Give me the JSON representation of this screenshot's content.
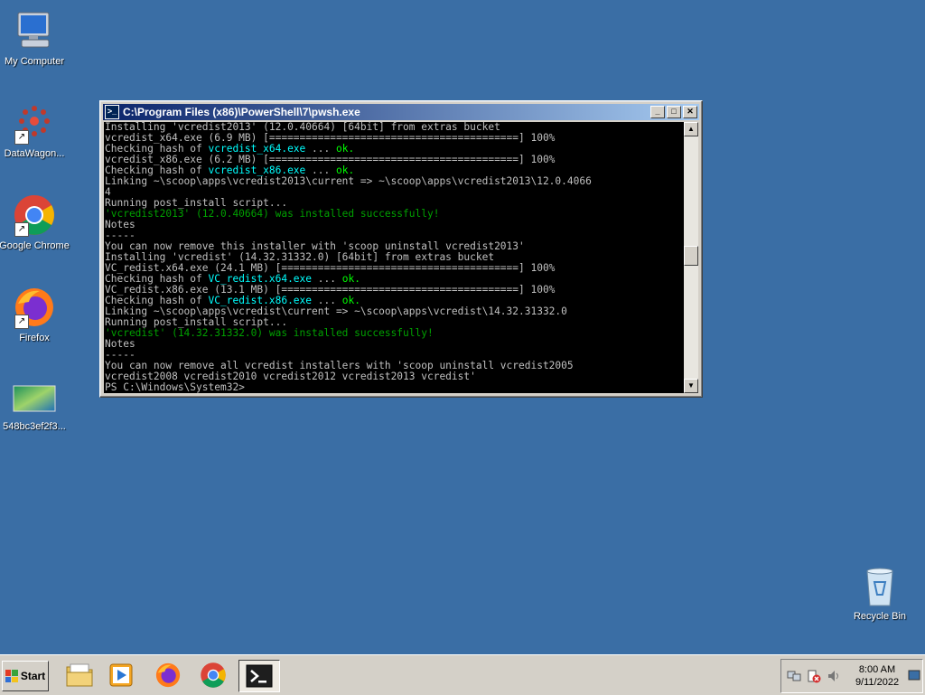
{
  "desktop": {
    "icons": [
      {
        "label": "My Computer"
      },
      {
        "label": "DataWagon..."
      },
      {
        "label": "Google Chrome"
      },
      {
        "label": "Firefox"
      },
      {
        "label": "548bc3ef2f3..."
      },
      {
        "label": "Recycle Bin"
      }
    ]
  },
  "window": {
    "title": "C:\\Program Files (x86)\\PowerShell\\7\\pwsh.exe",
    "minimize": "_",
    "maximize": "□",
    "close": "✕",
    "lines": [
      [
        {
          "t": "Installing 'vcredist2013' (12.0.40664) [64bit] from extras bucket",
          "c": "w"
        }
      ],
      [
        {
          "t": "vcredist_x64.exe (6.9 MB) [=========================================] 100%",
          "c": "w"
        }
      ],
      [
        {
          "t": "Checking hash of ",
          "c": "w"
        },
        {
          "t": "vcredist_x64.exe",
          "c": "c"
        },
        {
          "t": " ... ",
          "c": "w"
        },
        {
          "t": "ok.",
          "c": "g"
        }
      ],
      [
        {
          "t": "vcredist_x86.exe (6.2 MB) [=========================================] 100%",
          "c": "w"
        }
      ],
      [
        {
          "t": "Checking hash of ",
          "c": "w"
        },
        {
          "t": "vcredist_x86.exe",
          "c": "c"
        },
        {
          "t": " ... ",
          "c": "w"
        },
        {
          "t": "ok.",
          "c": "g"
        }
      ],
      [
        {
          "t": "Linking ~\\scoop\\apps\\vcredist2013\\current => ~\\scoop\\apps\\vcredist2013\\12.0.4066",
          "c": "w"
        }
      ],
      [
        {
          "t": "4",
          "c": "w"
        }
      ],
      [
        {
          "t": "Running post_install script...",
          "c": "w"
        }
      ],
      [
        {
          "t": "'vcredist2013' (12.0.40664) was installed successfully!",
          "c": "d"
        }
      ],
      [
        {
          "t": "Notes",
          "c": "w"
        }
      ],
      [
        {
          "t": "-----",
          "c": "w"
        }
      ],
      [
        {
          "t": "You can now remove this installer with 'scoop uninstall vcredist2013'",
          "c": "w"
        }
      ],
      [
        {
          "t": "Installing 'vcredist' (14.32.31332.0) [64bit] from extras bucket",
          "c": "w"
        }
      ],
      [
        {
          "t": "VC_redist.x64.exe (24.1 MB) [=======================================] 100%",
          "c": "w"
        }
      ],
      [
        {
          "t": "Checking hash of ",
          "c": "w"
        },
        {
          "t": "VC_redist.x64.exe",
          "c": "c"
        },
        {
          "t": " ... ",
          "c": "w"
        },
        {
          "t": "ok.",
          "c": "g"
        }
      ],
      [
        {
          "t": "VC_redist.x86.exe (13.1 MB) [=======================================] 100%",
          "c": "w"
        }
      ],
      [
        {
          "t": "Checking hash of ",
          "c": "w"
        },
        {
          "t": "VC_redist.x86.exe",
          "c": "c"
        },
        {
          "t": " ... ",
          "c": "w"
        },
        {
          "t": "ok.",
          "c": "g"
        }
      ],
      [
        {
          "t": "Linking ~\\scoop\\apps\\vcredist\\current => ~\\scoop\\apps\\vcredist\\14.32.31332.0",
          "c": "w"
        }
      ],
      [
        {
          "t": "Running post_install script...",
          "c": "w"
        }
      ],
      [
        {
          "t": "'vcredist' (14.32.31332.0) was installed successfully!",
          "c": "d"
        }
      ],
      [
        {
          "t": "Notes",
          "c": "w"
        }
      ],
      [
        {
          "t": "-----",
          "c": "w"
        }
      ],
      [
        {
          "t": "You can now remove all vcredist installers with 'scoop uninstall vcredist2005",
          "c": "w"
        }
      ],
      [
        {
          "t": "vcredist2008 vcredist2010 vcredist2012 vcredist2013 vcredist'",
          "c": "w"
        }
      ],
      [
        {
          "t": "PS C:\\Windows\\System32>",
          "c": "w"
        }
      ]
    ]
  },
  "taskbar": {
    "start_label": "Start",
    "clock_time": "8:00 AM",
    "clock_date": "9/11/2022"
  }
}
